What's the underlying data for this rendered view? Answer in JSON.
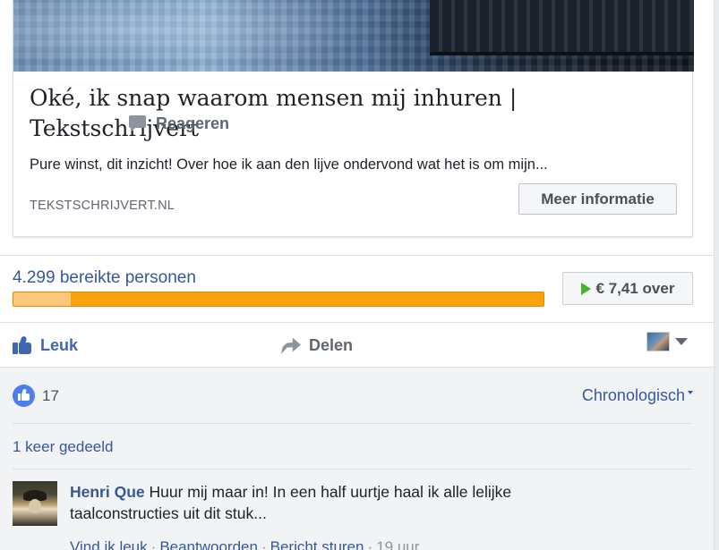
{
  "link_card": {
    "title": "Oké, ik snap waarom mensen mij inhuren | Tekstschrijvert",
    "description": "Pure winst, dit inzicht! Over hoe ik aan den lijve ondervond wat het is om mijn...",
    "domain": "TEKSTSCHRIJVERT.NL",
    "cta_label": "Meer informatie"
  },
  "reach": {
    "text": "4.299 bereikte personen",
    "organic_fraction": 0.108,
    "paid_fraction": 0.892,
    "budget_label": "€ 7,41 over"
  },
  "actions": {
    "like": "Leuk",
    "comment": "Reageren",
    "share": "Delen"
  },
  "reactions": {
    "count": "17",
    "sort_label": "Chronologisch"
  },
  "shares": {
    "text": "1 keer gedeeld"
  },
  "comment": {
    "author": "Henri Que",
    "text": "Huur mij maar in! In een half uurtje haal ik alle lelijke taalconstructies uit dit stuk...",
    "like_label": "Vind ik leuk",
    "reply_label": "Beantwoorden",
    "message_label": "Bericht sturen",
    "time": "19 uur"
  },
  "colors": {
    "link_blue": "#365899",
    "like_blue": "#4267b2",
    "paid_orange": "#f7a30e",
    "organic_orange": "#fdc77b",
    "play_green": "#42b72a"
  },
  "icons": {
    "like": "thumbs-up-icon",
    "comment": "comment-bubble-icon",
    "share": "share-arrow-icon",
    "budget": "play-icon",
    "select": "chevron-down-icon"
  }
}
